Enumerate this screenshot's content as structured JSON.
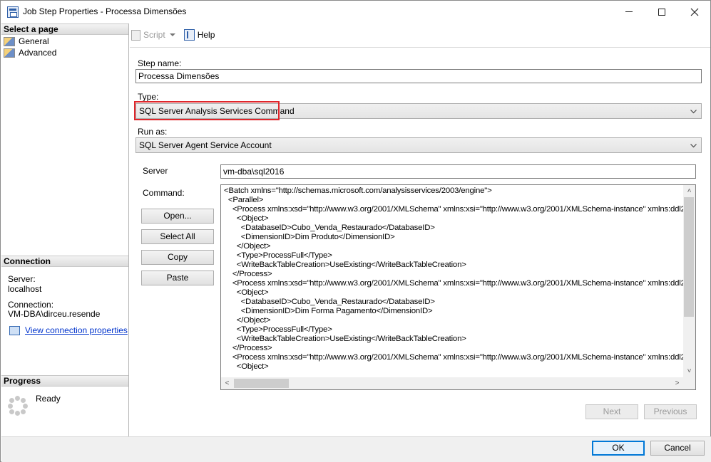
{
  "window": {
    "title": "Job Step Properties - Processa Dimensões"
  },
  "left_pane": {
    "select_page_header": "Select a page",
    "pages": [
      {
        "label": "General"
      },
      {
        "label": "Advanced"
      }
    ],
    "connection_header": "Connection",
    "server_label": "Server:",
    "server_value": "localhost",
    "connection_label": "Connection:",
    "connection_value": "VM-DBA\\dirceu.resende",
    "view_connection_link": "View connection properties",
    "progress_header": "Progress",
    "progress_status": "Ready"
  },
  "toolbar": {
    "script_label": "Script",
    "help_label": "Help"
  },
  "form": {
    "step_name_label": "Step name:",
    "step_name_value": "Processa Dimensões",
    "type_label": "Type:",
    "type_value": "SQL Server Analysis Services Command",
    "run_as_label": "Run as:",
    "run_as_value": "SQL Server Agent Service Account",
    "server_label": "Server",
    "server_value": "vm-dba\\sql2016",
    "command_label": "Command:",
    "open_button": "Open...",
    "select_all_button": "Select All",
    "copy_button": "Copy",
    "paste_button": "Paste",
    "command_lines": [
      "<Batch xmlns=\"http://schemas.microsoft.com/analysisservices/2003/engine\">",
      "  <Parallel>",
      "    <Process xmlns:xsd=\"http://www.w3.org/2001/XMLSchema\" xmlns:xsi=\"http://www.w3.org/2001/XMLSchema-instance\" xmlns:ddl2",
      "      <Object>",
      "        <DatabaseID>Cubo_Venda_Restaurado</DatabaseID>",
      "        <DimensionID>Dim Produto</DimensionID>",
      "      </Object>",
      "      <Type>ProcessFull</Type>",
      "      <WriteBackTableCreation>UseExisting</WriteBackTableCreation>",
      "    </Process>",
      "    <Process xmlns:xsd=\"http://www.w3.org/2001/XMLSchema\" xmlns:xsi=\"http://www.w3.org/2001/XMLSchema-instance\" xmlns:ddl2",
      "      <Object>",
      "        <DatabaseID>Cubo_Venda_Restaurado</DatabaseID>",
      "        <DimensionID>Dim Forma Pagamento</DimensionID>",
      "      </Object>",
      "      <Type>ProcessFull</Type>",
      "      <WriteBackTableCreation>UseExisting</WriteBackTableCreation>",
      "    </Process>",
      "    <Process xmlns:xsd=\"http://www.w3.org/2001/XMLSchema\" xmlns:xsi=\"http://www.w3.org/2001/XMLSchema-instance\" xmlns:ddl2",
      "      <Object>"
    ],
    "next_button": "Next",
    "previous_button": "Previous"
  },
  "footer": {
    "ok_button": "OK",
    "cancel_button": "Cancel"
  },
  "icons": {
    "app": "job-step-icon",
    "page": "property-page-icon",
    "connection": "connection-properties-icon",
    "progress": "progress-spinner-icon"
  }
}
